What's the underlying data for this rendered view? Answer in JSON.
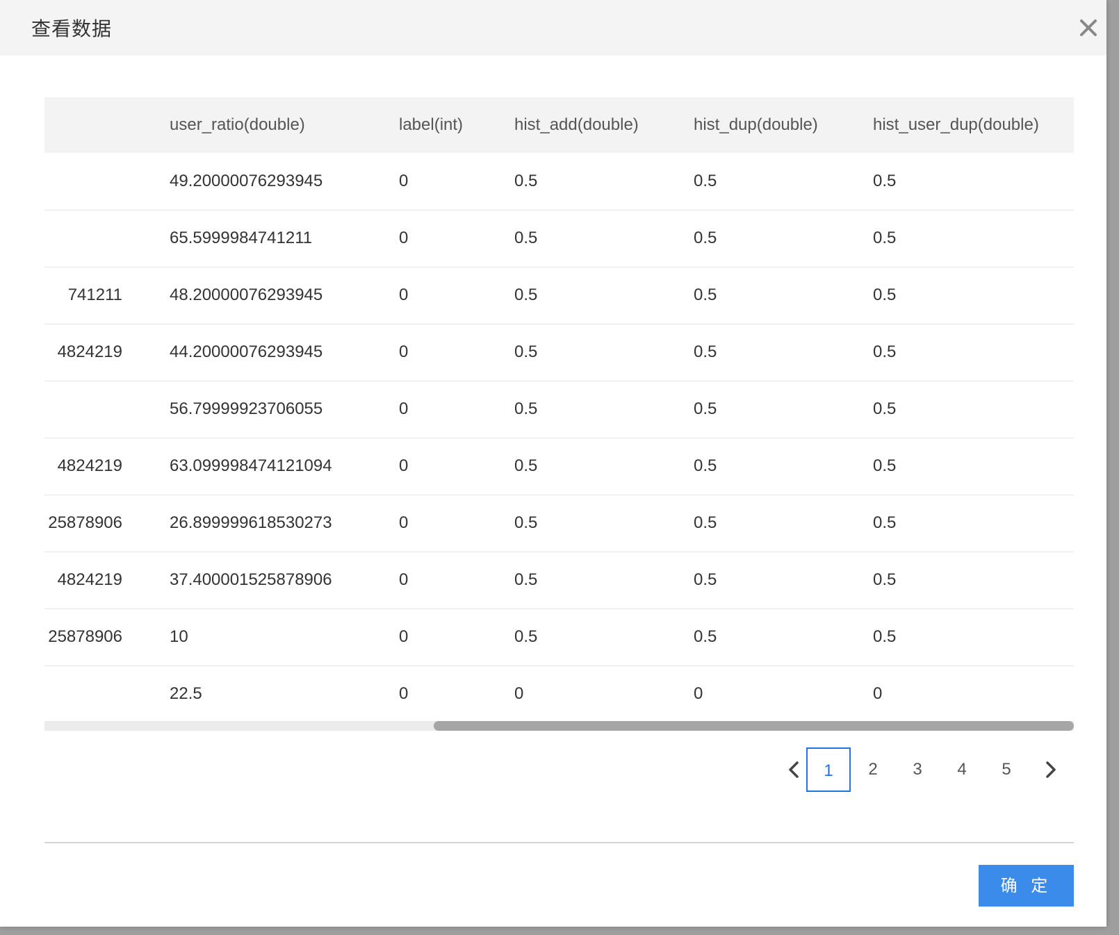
{
  "dialog": {
    "title": "查看数据",
    "close_symbol": "✕",
    "close_icon": "close-icon"
  },
  "table": {
    "columns": [
      "user_ratio(double)",
      "label(int)",
      "hist_add(double)",
      "hist_dup(double)",
      "hist_user_dup(double)"
    ],
    "rows": [
      {
        "prev": "",
        "user_ratio": "49.20000076293945",
        "label": "0",
        "hist_add": "0.5",
        "hist_dup": "0.5",
        "hist_user_dup": "0.5"
      },
      {
        "prev": "",
        "user_ratio": "65.5999984741211",
        "label": "0",
        "hist_add": "0.5",
        "hist_dup": "0.5",
        "hist_user_dup": "0.5"
      },
      {
        "prev": "741211",
        "user_ratio": "48.20000076293945",
        "label": "0",
        "hist_add": "0.5",
        "hist_dup": "0.5",
        "hist_user_dup": "0.5"
      },
      {
        "prev": "4824219",
        "user_ratio": "44.20000076293945",
        "label": "0",
        "hist_add": "0.5",
        "hist_dup": "0.5",
        "hist_user_dup": "0.5"
      },
      {
        "prev": "",
        "user_ratio": "56.79999923706055",
        "label": "0",
        "hist_add": "0.5",
        "hist_dup": "0.5",
        "hist_user_dup": "0.5"
      },
      {
        "prev": "4824219",
        "user_ratio": "63.099998474121094",
        "label": "0",
        "hist_add": "0.5",
        "hist_dup": "0.5",
        "hist_user_dup": "0.5"
      },
      {
        "prev": "25878906",
        "user_ratio": "26.899999618530273",
        "label": "0",
        "hist_add": "0.5",
        "hist_dup": "0.5",
        "hist_user_dup": "0.5"
      },
      {
        "prev": "4824219",
        "user_ratio": "37.400001525878906",
        "label": "0",
        "hist_add": "0.5",
        "hist_dup": "0.5",
        "hist_user_dup": "0.5"
      },
      {
        "prev": "25878906",
        "user_ratio": "10",
        "label": "0",
        "hist_add": "0.5",
        "hist_dup": "0.5",
        "hist_user_dup": "0.5"
      },
      {
        "prev": "",
        "user_ratio": "22.5",
        "label": "0",
        "hist_add": "0",
        "hist_dup": "0",
        "hist_user_dup": "0"
      }
    ]
  },
  "horizontal_scroll": {
    "position_fraction": 0.38
  },
  "pagination": {
    "prev_icon": "chevron-left-icon",
    "next_icon": "chevron-right-icon",
    "pages": [
      "1",
      "2",
      "3",
      "4",
      "5"
    ],
    "current": "1"
  },
  "footer": {
    "confirm_label": "确 定"
  },
  "colors": {
    "accent": "#1f73e6",
    "button": "#3b8beb",
    "header_bg": "#f4f4f4"
  }
}
